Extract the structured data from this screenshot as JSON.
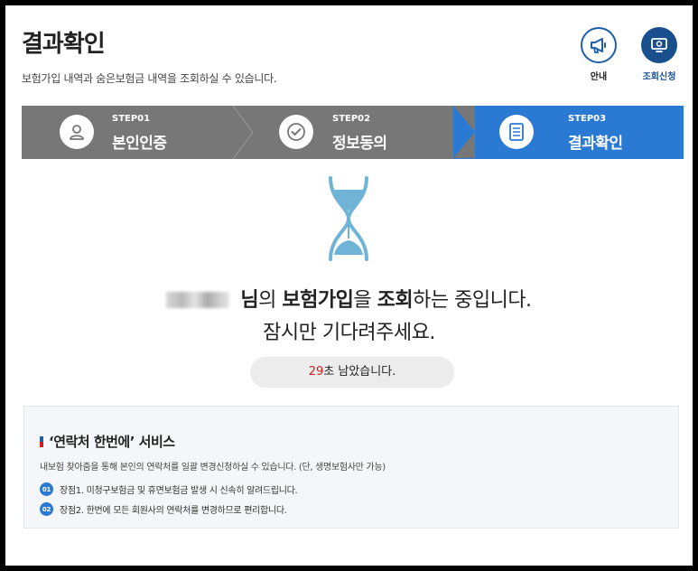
{
  "header": {
    "title": "결과확인",
    "description": "보험가입 내역과 숨은보험금 내역을 조회하실 수 있습니다."
  },
  "actions": {
    "guide_label": "안내",
    "apply_label": "조회신청"
  },
  "steps": [
    {
      "step": "STEP01",
      "label": "본인인증",
      "icon": "user-icon",
      "active": false
    },
    {
      "step": "STEP02",
      "label": "정보동의",
      "icon": "check-circle-icon",
      "active": false
    },
    {
      "step": "STEP03",
      "label": "결과확인",
      "icon": "document-icon",
      "active": true
    }
  ],
  "status": {
    "name_suffix": "님",
    "particle_of": "의",
    "keyword1": "보험가입",
    "particle_obj": "을",
    "keyword2": "조회",
    "rest": "하는 중입니다.",
    "line2": "잠시만 기다려주세요."
  },
  "timer": {
    "seconds": "29",
    "suffix": "초 남았습니다."
  },
  "service": {
    "title": "‘연락처 한번에’ 서비스",
    "description": "내보험 찾아줌을 통해 본인의 연락처를 일괄 변경신청하실 수 있습니다. (단, 생명보험사만 가능)",
    "items": [
      {
        "num": "01",
        "text": "장점1. 미청구보험금 및 휴면보험금 발생 시 신속히 알려드립니다."
      },
      {
        "num": "02",
        "text": "장점2. 한번에 모든 회원사의 연락처를 변경하므로 편리합니다."
      }
    ]
  },
  "colors": {
    "accent": "#2a79d3",
    "step_inactive": "#777777",
    "timer_number": "#d21c1c",
    "hourglass": "#6fb4d6"
  }
}
